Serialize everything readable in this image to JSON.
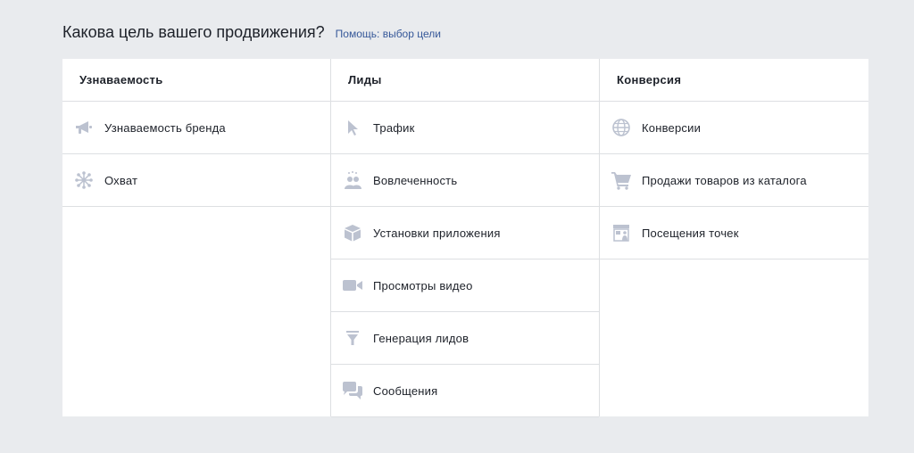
{
  "header": {
    "title": "Какова цель вашего продвижения?",
    "help_link": "Помощь: выбор цели"
  },
  "columns": [
    {
      "title": "Узнаваемость",
      "items": [
        {
          "label": "Узнаваемость бренда",
          "icon": "megaphone-icon"
        },
        {
          "label": "Охват",
          "icon": "reach-icon"
        }
      ]
    },
    {
      "title": "Лиды",
      "items": [
        {
          "label": "Трафик",
          "icon": "cursor-icon"
        },
        {
          "label": "Вовлеченность",
          "icon": "people-icon"
        },
        {
          "label": "Установки приложения",
          "icon": "box-icon"
        },
        {
          "label": "Просмотры видео",
          "icon": "video-camera-icon"
        },
        {
          "label": "Генерация лидов",
          "icon": "funnel-icon"
        },
        {
          "label": "Сообщения",
          "icon": "chat-bubbles-icon"
        }
      ]
    },
    {
      "title": "Конверсия",
      "items": [
        {
          "label": "Конверсии",
          "icon": "globe-icon"
        },
        {
          "label": "Продажи товаров из каталога",
          "icon": "cart-icon"
        },
        {
          "label": "Посещения точек",
          "icon": "store-icon"
        }
      ]
    }
  ],
  "colors": {
    "background": "#e9ebee",
    "panel": "#ffffff",
    "border": "#dddfe2",
    "link": "#365899",
    "icon": "#bcc2d0",
    "text": "#1d2129"
  }
}
